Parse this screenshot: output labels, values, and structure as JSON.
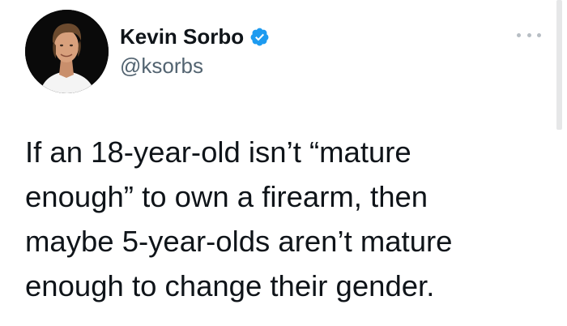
{
  "author": {
    "display_name": "Kevin Sorbo",
    "handle": "@ksorbs",
    "verified": true,
    "avatar_icon": "profile-photo"
  },
  "tweet": {
    "text_lines": [
      "If an 18-year-old isn’t “mature",
      "enough” to own a firearm, then",
      "maybe 5-year-olds aren’t mature",
      "enough to change their gender."
    ]
  },
  "actions": {
    "more_icon": "more-horizontal-icon"
  },
  "colors": {
    "text": "#0f1419",
    "secondary_text": "#536471",
    "verified_blue": "#1d9bf0",
    "background": "#ffffff"
  }
}
